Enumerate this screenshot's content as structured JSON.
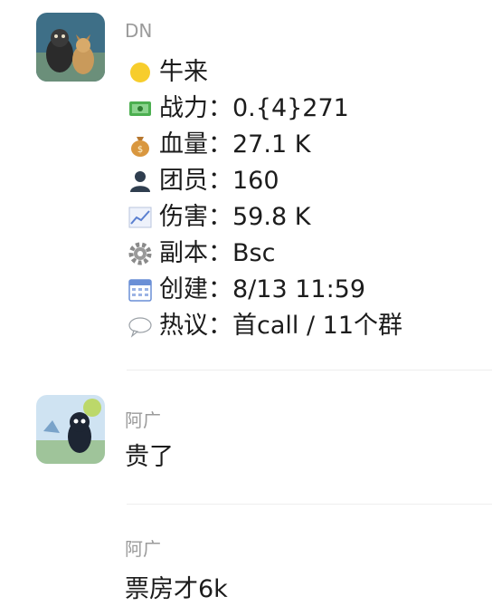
{
  "messages": [
    {
      "sender": "DN",
      "avatar_icon": "dogs-photo-avatar",
      "lines": [
        {
          "icon": "yellow-circle-icon",
          "label": "牛来",
          "value": ""
        },
        {
          "icon": "money-icon",
          "label": "战力：",
          "value": "0.{4}271"
        },
        {
          "icon": "money-bag-icon",
          "label": "血量：",
          "value": "27.1 K"
        },
        {
          "icon": "person-icon",
          "label": "团员：",
          "value": "160"
        },
        {
          "icon": "chart-icon",
          "label": "伤害：",
          "value": "59.8 K"
        },
        {
          "icon": "gear-icon",
          "label": "副本：",
          "value": "Bsc"
        },
        {
          "icon": "calendar-icon",
          "label": "创建：",
          "value": "8/13 11:59"
        },
        {
          "icon": "speech-bubble-icon",
          "label": "热议：",
          "value": "首call / 11个群"
        }
      ]
    },
    {
      "sender": "阿广",
      "avatar_icon": "cartoon-avatar",
      "text": "贵了"
    },
    {
      "sender": "阿广",
      "text": "票房才6k"
    }
  ],
  "colors": {
    "sender": "#9b9b9b",
    "text": "#1c1c1c",
    "separator": "#eeeeee"
  }
}
